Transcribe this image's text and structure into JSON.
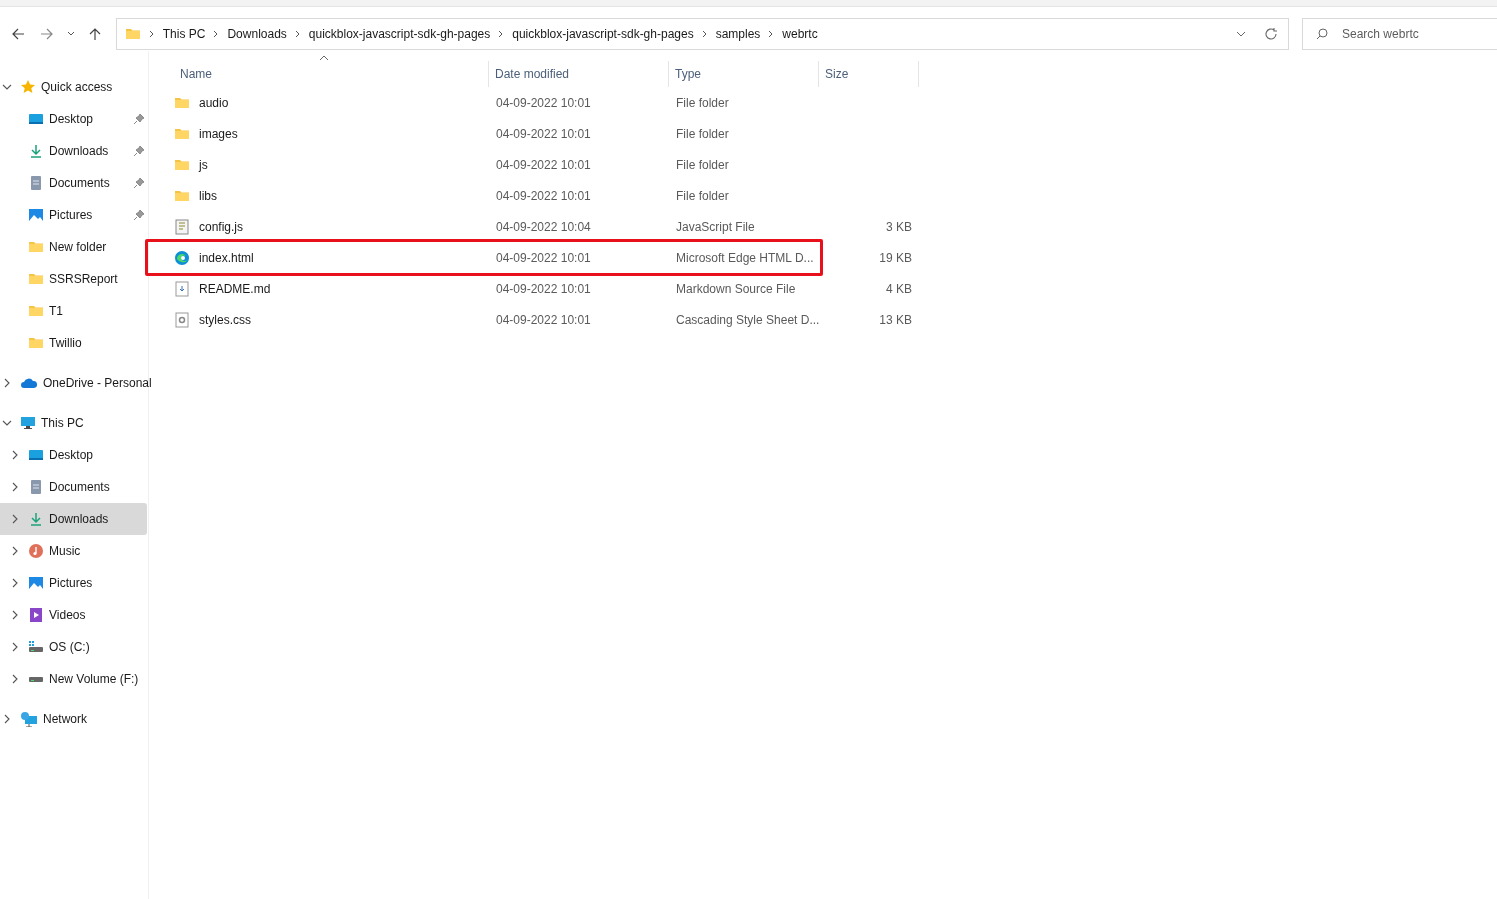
{
  "address_bar": {
    "crumbs": [
      "This PC",
      "Downloads",
      "quickblox-javascript-sdk-gh-pages",
      "quickblox-javascript-sdk-gh-pages",
      "samples",
      "webrtc"
    ]
  },
  "search": {
    "placeholder": "Search webrtc"
  },
  "sidebar": {
    "items": [
      {
        "label": "Quick access",
        "kind": "star",
        "expanded": true,
        "selected": false,
        "children": [
          {
            "label": "Desktop",
            "kind": "desktop",
            "pinned": true,
            "selected": false
          },
          {
            "label": "Downloads",
            "kind": "download",
            "pinned": true,
            "selected": false
          },
          {
            "label": "Documents",
            "kind": "documents",
            "pinned": true,
            "selected": false
          },
          {
            "label": "Pictures",
            "kind": "pictures",
            "pinned": true,
            "selected": false
          },
          {
            "label": "New folder",
            "kind": "folder",
            "pinned": false,
            "selected": false
          },
          {
            "label": "SSRSReport",
            "kind": "folder",
            "pinned": false,
            "selected": false
          },
          {
            "label": "T1",
            "kind": "folder",
            "pinned": false,
            "selected": false
          },
          {
            "label": "Twillio",
            "kind": "folder",
            "pinned": false,
            "selected": false
          }
        ]
      },
      {
        "label": "OneDrive - Personal",
        "kind": "cloud",
        "expanded": false,
        "selected": false
      },
      {
        "label": "This PC",
        "kind": "pc",
        "expanded": true,
        "selected": false,
        "children": [
          {
            "label": "Desktop",
            "kind": "desktop",
            "expanded": false,
            "selected": false
          },
          {
            "label": "Documents",
            "kind": "documents",
            "expanded": false,
            "selected": false
          },
          {
            "label": "Downloads",
            "kind": "download",
            "expanded": false,
            "selected": true
          },
          {
            "label": "Music",
            "kind": "music",
            "expanded": false,
            "selected": false
          },
          {
            "label": "Pictures",
            "kind": "pictures",
            "expanded": false,
            "selected": false
          },
          {
            "label": "Videos",
            "kind": "videos",
            "expanded": false,
            "selected": false
          },
          {
            "label": "OS (C:)",
            "kind": "osdrive",
            "expanded": false,
            "selected": false
          },
          {
            "label": "New Volume (F:)",
            "kind": "drive",
            "expanded": false,
            "selected": false
          }
        ]
      },
      {
        "label": "Network",
        "kind": "network",
        "expanded": false,
        "selected": false
      }
    ]
  },
  "table": {
    "columns": [
      {
        "label": "Name",
        "sorted": true
      },
      {
        "label": "Date modified",
        "sorted": false
      },
      {
        "label": "Type",
        "sorted": false
      },
      {
        "label": "Size",
        "sorted": false
      }
    ],
    "rows": [
      {
        "kind": "folder",
        "name": "audio",
        "date": "04-09-2022 10:01",
        "type": "File folder",
        "highlighted": false
      },
      {
        "kind": "folder",
        "name": "images",
        "date": "04-09-2022 10:01",
        "type": "File folder",
        "highlighted": false
      },
      {
        "kind": "folder",
        "name": "js",
        "date": "04-09-2022 10:01",
        "type": "File folder",
        "highlighted": false
      },
      {
        "kind": "folder",
        "name": "libs",
        "date": "04-09-2022 10:01",
        "type": "File folder",
        "highlighted": false
      },
      {
        "kind": "js",
        "name": "config.js",
        "date": "04-09-2022 10:04",
        "type": "JavaScript File",
        "size": "3 KB",
        "highlighted": false
      },
      {
        "kind": "edge",
        "name": "index.html",
        "date": "04-09-2022 10:01",
        "type": "Microsoft Edge HTML D...",
        "size": "19 KB",
        "highlighted": true
      },
      {
        "kind": "md",
        "name": "README.md",
        "date": "04-09-2022 10:01",
        "type": "Markdown Source File",
        "size": "4 KB",
        "highlighted": false
      },
      {
        "kind": "css",
        "name": "styles.css",
        "date": "04-09-2022 10:01",
        "type": "Cascading Style Sheet D...",
        "size": "13 KB",
        "highlighted": false
      }
    ]
  }
}
